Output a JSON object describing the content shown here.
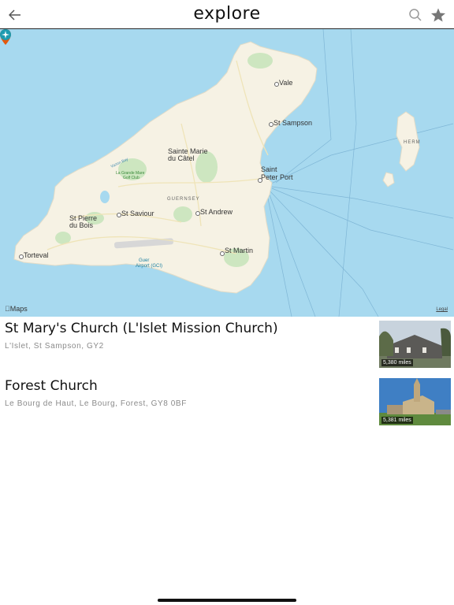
{
  "header": {
    "title": "explore",
    "back_icon": "arrow-left-icon",
    "search_icon": "search-icon",
    "favorite_icon": "star-icon"
  },
  "map": {
    "place_labels": {
      "vale": "Vale",
      "st_sampson": "St Sampson",
      "sainte_marie": "Sainte Marie",
      "du_catel": "du Câtel",
      "saint": "Saint",
      "peter_port": "Peter Port",
      "guernsey": "GUERNSEY",
      "st_saviour": "St Saviour",
      "st_andrew": "St Andrew",
      "st_pierre": "St Pierre",
      "du_bois": "du Bois",
      "torteval": "Torteval",
      "st_martin": "St Martin",
      "airport_1": "Guer",
      "airport_2": "Airport (GCI)",
      "golf_1": "La Grande Mare",
      "golf_2": "Golf Club",
      "vazon": "Vazon Bay",
      "herm": "HERM"
    },
    "maps_credit": "Maps",
    "legal": "Legal",
    "colors": {
      "water": "#a7d9ef",
      "land": "#f6f2e4",
      "park": "#cde6c0",
      "pin": "#e4580c"
    }
  },
  "results": [
    {
      "title": "St Mary's Church (L'Islet Mission Church)",
      "address": "L'Islet, St Sampson, GY2",
      "distance": "5,380 miles"
    },
    {
      "title": "Forest Church",
      "address": "Le Bourg de Haut, Le Bourg, Forest, GY8 0BF",
      "distance": "5,381 miles"
    }
  ]
}
